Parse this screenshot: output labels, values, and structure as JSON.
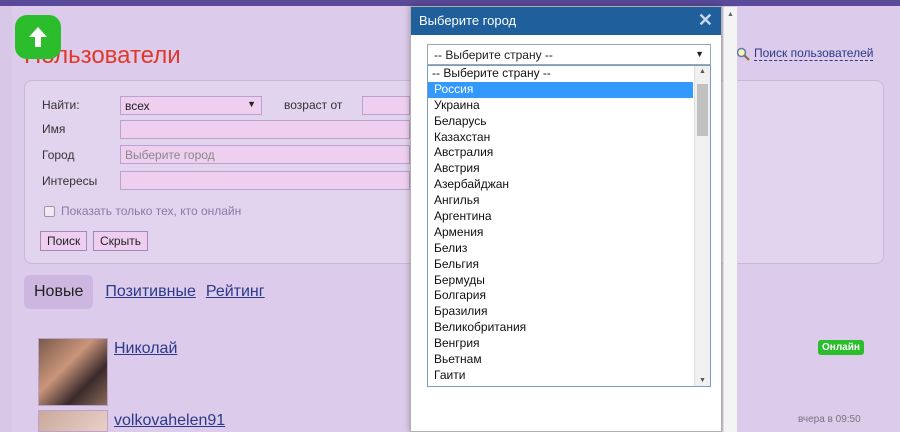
{
  "page": {
    "title": "Пользователи",
    "search_link": "Поиск пользователей"
  },
  "filter": {
    "find_label": "Найти:",
    "find_value": "всех",
    "age_label": "возраст от",
    "name_label": "Имя",
    "city_label": "Город",
    "city_placeholder": "Выберите город",
    "interests_label": "Интересы",
    "online_only_label": "Показать только тех, кто онлайн",
    "search_button": "Поиск",
    "hide_button": "Скрыть"
  },
  "tabs": [
    {
      "label": "Новые",
      "active": true
    },
    {
      "label": "Позитивные",
      "active": false
    },
    {
      "label": "Рейтинг",
      "active": false
    }
  ],
  "users": [
    {
      "name": "Николай",
      "status": "Онлайн"
    },
    {
      "name": "volkovahelen91",
      "status": "вчера в 09:50"
    }
  ],
  "dialog": {
    "title": "Выберите город",
    "close_glyph": "✕",
    "country_select": "-- Выберите страну --",
    "options": [
      "-- Выберите страну --",
      "Россия",
      "Украина",
      "Беларусь",
      "Казахстан",
      "Австралия",
      "Австрия",
      "Азербайджан",
      "Ангилья",
      "Аргентина",
      "Армения",
      "Белиз",
      "Бельгия",
      "Бермуды",
      "Болгария",
      "Бразилия",
      "Великобритания",
      "Венгрия",
      "Вьетнам",
      "Гаити"
    ],
    "selected_index": 1
  },
  "colors": {
    "accent_title": "#e0392b",
    "online_badge": "#2bbd2b",
    "dialog_header": "#1f5f9c",
    "selected_option": "#3399ff"
  }
}
